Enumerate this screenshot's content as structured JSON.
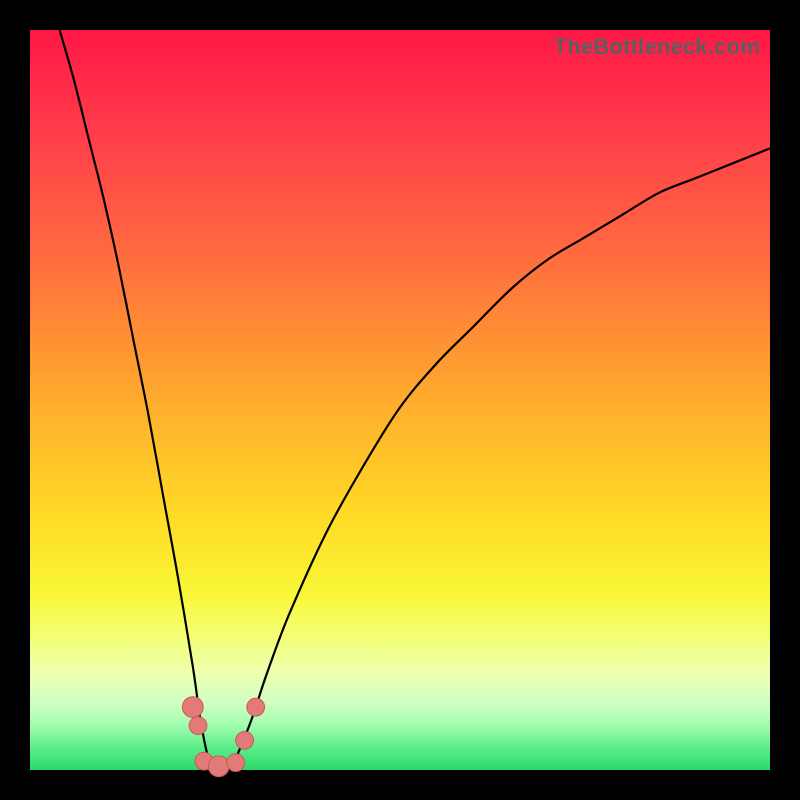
{
  "watermark": "TheBottleneck.com",
  "colors": {
    "background": "#000000",
    "gradient_top": "#ff1846",
    "gradient_bottom": "#2bd96e",
    "curve_stroke": "#000000",
    "marker_fill": "#e27a77",
    "marker_stroke": "#c75a56"
  },
  "chart_data": {
    "type": "line",
    "title": "",
    "xlabel": "",
    "ylabel": "",
    "xlim": [
      0,
      100
    ],
    "ylim": [
      0,
      100
    ],
    "curve": {
      "comment": "V-shaped bottleneck curve; minimum near x≈25, left branch steep to top-left, right branch shallower rising toward upper-right. Values are percent of plot width/height (origin bottom-left).",
      "points": [
        {
          "x": 4,
          "y": 100
        },
        {
          "x": 6,
          "y": 93
        },
        {
          "x": 8,
          "y": 85
        },
        {
          "x": 10,
          "y": 77
        },
        {
          "x": 12,
          "y": 68
        },
        {
          "x": 14,
          "y": 58
        },
        {
          "x": 16,
          "y": 48
        },
        {
          "x": 18,
          "y": 37
        },
        {
          "x": 20,
          "y": 26
        },
        {
          "x": 22,
          "y": 14
        },
        {
          "x": 23,
          "y": 7
        },
        {
          "x": 24,
          "y": 2
        },
        {
          "x": 25,
          "y": 0
        },
        {
          "x": 26,
          "y": 0
        },
        {
          "x": 27,
          "y": 0
        },
        {
          "x": 28,
          "y": 2
        },
        {
          "x": 30,
          "y": 7
        },
        {
          "x": 32,
          "y": 13
        },
        {
          "x": 35,
          "y": 21
        },
        {
          "x": 40,
          "y": 32
        },
        {
          "x": 45,
          "y": 41
        },
        {
          "x": 50,
          "y": 49
        },
        {
          "x": 55,
          "y": 55
        },
        {
          "x": 60,
          "y": 60
        },
        {
          "x": 65,
          "y": 65
        },
        {
          "x": 70,
          "y": 69
        },
        {
          "x": 75,
          "y": 72
        },
        {
          "x": 80,
          "y": 75
        },
        {
          "x": 85,
          "y": 78
        },
        {
          "x": 90,
          "y": 80
        },
        {
          "x": 95,
          "y": 82
        },
        {
          "x": 100,
          "y": 84
        }
      ]
    },
    "markers": [
      {
        "x": 22.0,
        "y": 8.5,
        "r": 1.4
      },
      {
        "x": 22.7,
        "y": 6.0,
        "r": 1.2
      },
      {
        "x": 23.5,
        "y": 1.2,
        "r": 1.2
      },
      {
        "x": 25.5,
        "y": 0.5,
        "r": 1.4
      },
      {
        "x": 27.8,
        "y": 1.0,
        "r": 1.2
      },
      {
        "x": 29.0,
        "y": 4.0,
        "r": 1.2
      },
      {
        "x": 30.5,
        "y": 8.5,
        "r": 1.2
      }
    ]
  }
}
